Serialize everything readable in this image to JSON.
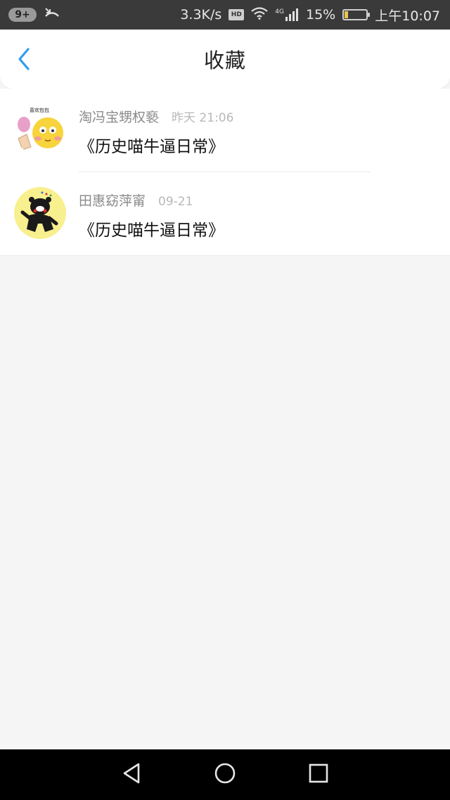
{
  "status_bar": {
    "notification_count": "9+",
    "network_speed": "3.3K/s",
    "hd_label": "HD",
    "signal_type": "4G",
    "battery": "15%",
    "time": "上午10:07",
    "battery_level": 0.15,
    "icons": [
      "missed-call-icon",
      "wifi-icon",
      "signal-icon",
      "battery-icon"
    ]
  },
  "nav": {
    "title": "收藏",
    "back_icon": "chevron-left-icon",
    "accent_color": "#2f9ef0"
  },
  "items": [
    {
      "name": "淘冯宝甥权褻",
      "time": "昨天 21:06",
      "title": "《历史喵牛逼日常》",
      "avatar": "sticker-emoji-clapping",
      "avatar_caption": "喜欢包包"
    },
    {
      "name": "田惠窈萍甯",
      "time": "09-21",
      "title": "《历史喵牛逼日常》",
      "avatar": "kumamon-sticker"
    }
  ],
  "system_nav": {
    "icons": [
      "back-triangle-icon",
      "home-circle-icon",
      "recents-square-icon"
    ]
  }
}
